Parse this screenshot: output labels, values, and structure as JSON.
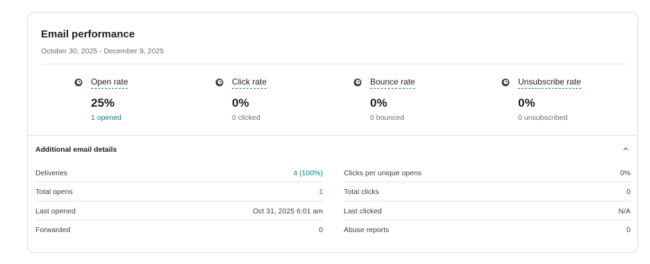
{
  "header": {
    "title": "Email performance",
    "date_range": "October 30, 2025 - December 9, 2025"
  },
  "stats": [
    {
      "label": "Open rate",
      "value": "25%",
      "sub": "1 opened",
      "sub_color": "#007c89",
      "icon": "mailchimp-freddie-icon"
    },
    {
      "label": "Click rate",
      "value": "0%",
      "sub": "0 clicked",
      "sub_color": "#6b6b6b",
      "icon": "mailchimp-freddie-icon"
    },
    {
      "label": "Bounce rate",
      "value": "0%",
      "sub": "0 bounced",
      "sub_color": "#6b6b6b",
      "icon": "mailchimp-freddie-icon"
    },
    {
      "label": "Unsubscribe rate",
      "value": "0%",
      "sub": "0 unsubscribed",
      "sub_color": "#6b6b6b",
      "icon": "mailchimp-freddie-icon"
    }
  ],
  "details": {
    "title": "Additional email details",
    "collapse_icon": "chevron-up-icon",
    "left_rows": [
      {
        "key": "Deliveries",
        "value": "4 (100%)",
        "highlight": true
      },
      {
        "key": "Total opens",
        "value": "1",
        "highlight": true
      },
      {
        "key": "Last opened",
        "value": "Oct 31, 2025 6:01 am",
        "highlight": false
      },
      {
        "key": "Forwarded",
        "value": "0",
        "highlight": false
      }
    ],
    "right_rows": [
      {
        "key": "Clicks per unique opens",
        "value": "0%",
        "highlight": false
      },
      {
        "key": "Total clicks",
        "value": "0",
        "highlight": false
      },
      {
        "key": "Last clicked",
        "value": "N/A",
        "highlight": false
      },
      {
        "key": "Abuse reports",
        "value": "0",
        "highlight": false
      }
    ]
  },
  "colors": {
    "accent_teal": "#007c89",
    "dashed_underline": "#1f6f8b",
    "text": "#241c15",
    "muted": "#6b6b6b"
  }
}
